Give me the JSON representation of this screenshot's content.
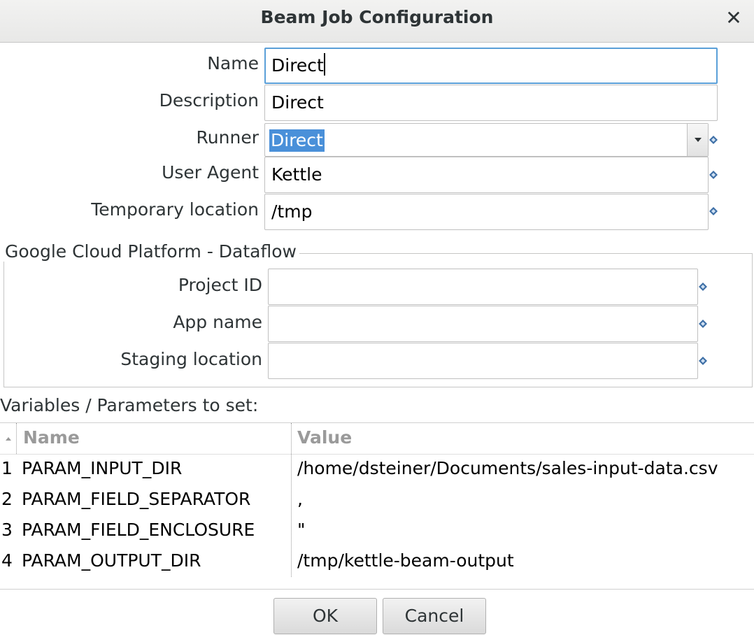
{
  "dialog": {
    "title": "Beam Job Configuration",
    "close_icon": "close-icon"
  },
  "form": {
    "name_label": "Name",
    "name_value": "Direct",
    "description_label": "Description",
    "description_value": "Direct",
    "runner_label": "Runner",
    "runner_value": "Direct",
    "user_agent_label": "User Agent",
    "user_agent_value": "Kettle",
    "temp_location_label": "Temporary location",
    "temp_location_value": "/tmp"
  },
  "gcp_group": {
    "title": "Google Cloud Platform - Dataflow",
    "project_id_label": "Project ID",
    "project_id_value": "",
    "app_name_label": "App name",
    "app_name_value": "",
    "staging_location_label": "Staging location",
    "staging_location_value": ""
  },
  "variables": {
    "label": "Variables / Parameters to set:",
    "columns": [
      "Name",
      "Value"
    ],
    "rows": [
      {
        "num": "1",
        "name": "PARAM_INPUT_DIR",
        "value": "/home/dsteiner/Documents/sales-input-data.csv"
      },
      {
        "num": "2",
        "name": "PARAM_FIELD_SEPARATOR",
        "value": ","
      },
      {
        "num": "3",
        "name": "PARAM_FIELD_ENCLOSURE",
        "value": "\""
      },
      {
        "num": "4",
        "name": "PARAM_OUTPUT_DIR",
        "value": "/tmp/kettle-beam-output"
      }
    ]
  },
  "buttons": {
    "ok": "OK",
    "cancel": "Cancel"
  },
  "colors": {
    "selection": "#4a90d9",
    "focus_border": "#5a9fd8",
    "variable_icon": "#3d6fa6"
  }
}
